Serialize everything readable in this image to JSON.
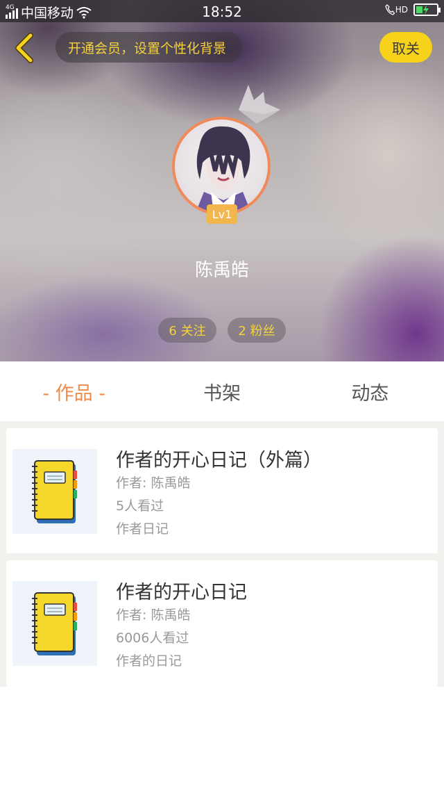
{
  "status_bar": {
    "network_type": "4G",
    "carrier": "中国移动",
    "time": "18:52",
    "hd_label": "HD"
  },
  "header": {
    "vip_promo": "开通会员，设置个性化背景",
    "cancel_label": "取关"
  },
  "profile": {
    "level": "Lv1",
    "username": "陈禹皓",
    "follow_label": "6 关注",
    "fans_label": "2 粉丝"
  },
  "tabs": [
    {
      "label": "- 作品 -",
      "active": true
    },
    {
      "label": "书架",
      "active": false
    },
    {
      "label": "动态",
      "active": false
    }
  ],
  "works": [
    {
      "title": "作者的开心日记（外篇）",
      "author": "作者: 陈禹皓",
      "views": "5人看过",
      "description": "作者日记"
    },
    {
      "title": "作者的开心日记",
      "author": "作者: 陈禹皓",
      "views": "6006人看过",
      "description": "作者的日记"
    }
  ],
  "colors": {
    "accent_yellow": "#f6d21b",
    "tab_active": "#f08a4b",
    "avatar_ring": "#f08a5a",
    "level_badge": "#f2b64c"
  },
  "icons": {
    "back": "chevron-left-icon",
    "crown": "crown-icon",
    "book": "notebook-icon"
  }
}
